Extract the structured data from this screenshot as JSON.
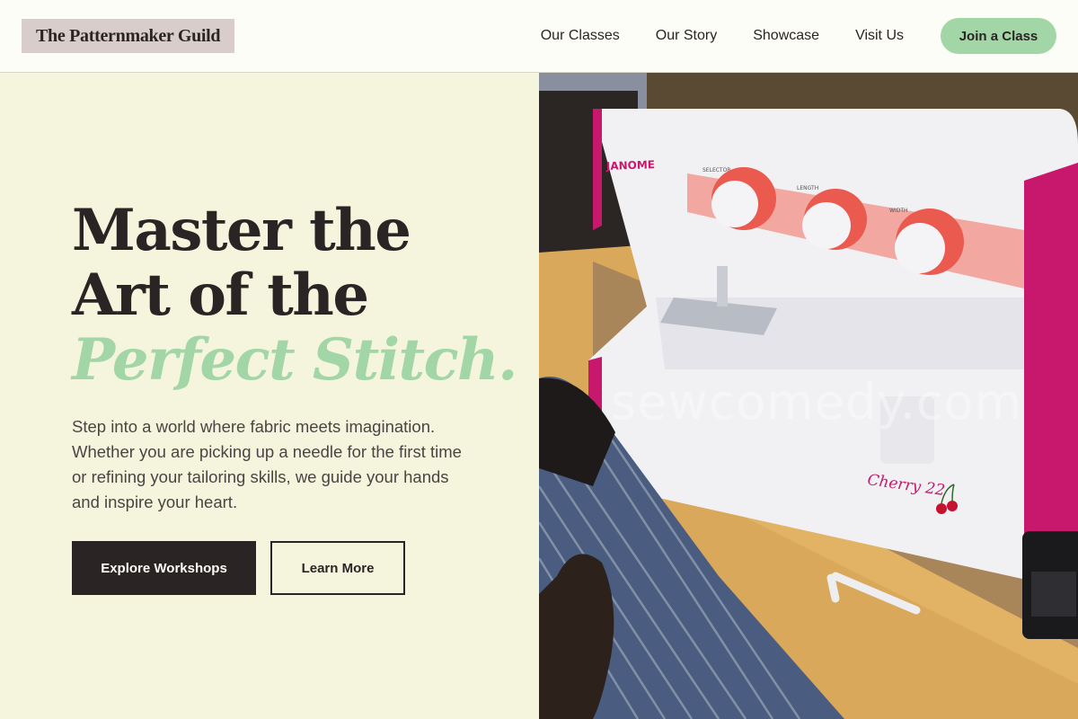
{
  "brand": {
    "name": "The Patternmaker Guild"
  },
  "nav": {
    "links": [
      "Our Classes",
      "Our Story",
      "Showcase",
      "Visit Us"
    ],
    "cta": "Join a Class"
  },
  "hero": {
    "headline_line1": "Master the",
    "headline_line2": "Art of the",
    "headline_accent": "Perfect Stitch.",
    "body": "Step into a world where fabric meets imagination. Whether you are picking up a needle for the first time or refining your tailoring skills, we guide your hands and inspire your heart.",
    "primary_button": "Explore Workshops",
    "secondary_button": "Learn More"
  },
  "photo": {
    "machine_brand": "JANOME",
    "model_label": "Cherry 22",
    "dial_labels": [
      "SELECTOR",
      "LENGTH",
      "WIDTH"
    ],
    "watermark": "sewcomedy.com"
  },
  "colors": {
    "accent_green": "#a3d6a6",
    "cream_background": "#f5f4dc",
    "dark_text": "#2a2524",
    "logo_background": "#d8cdcb",
    "machine_magenta": "#c8186e"
  }
}
